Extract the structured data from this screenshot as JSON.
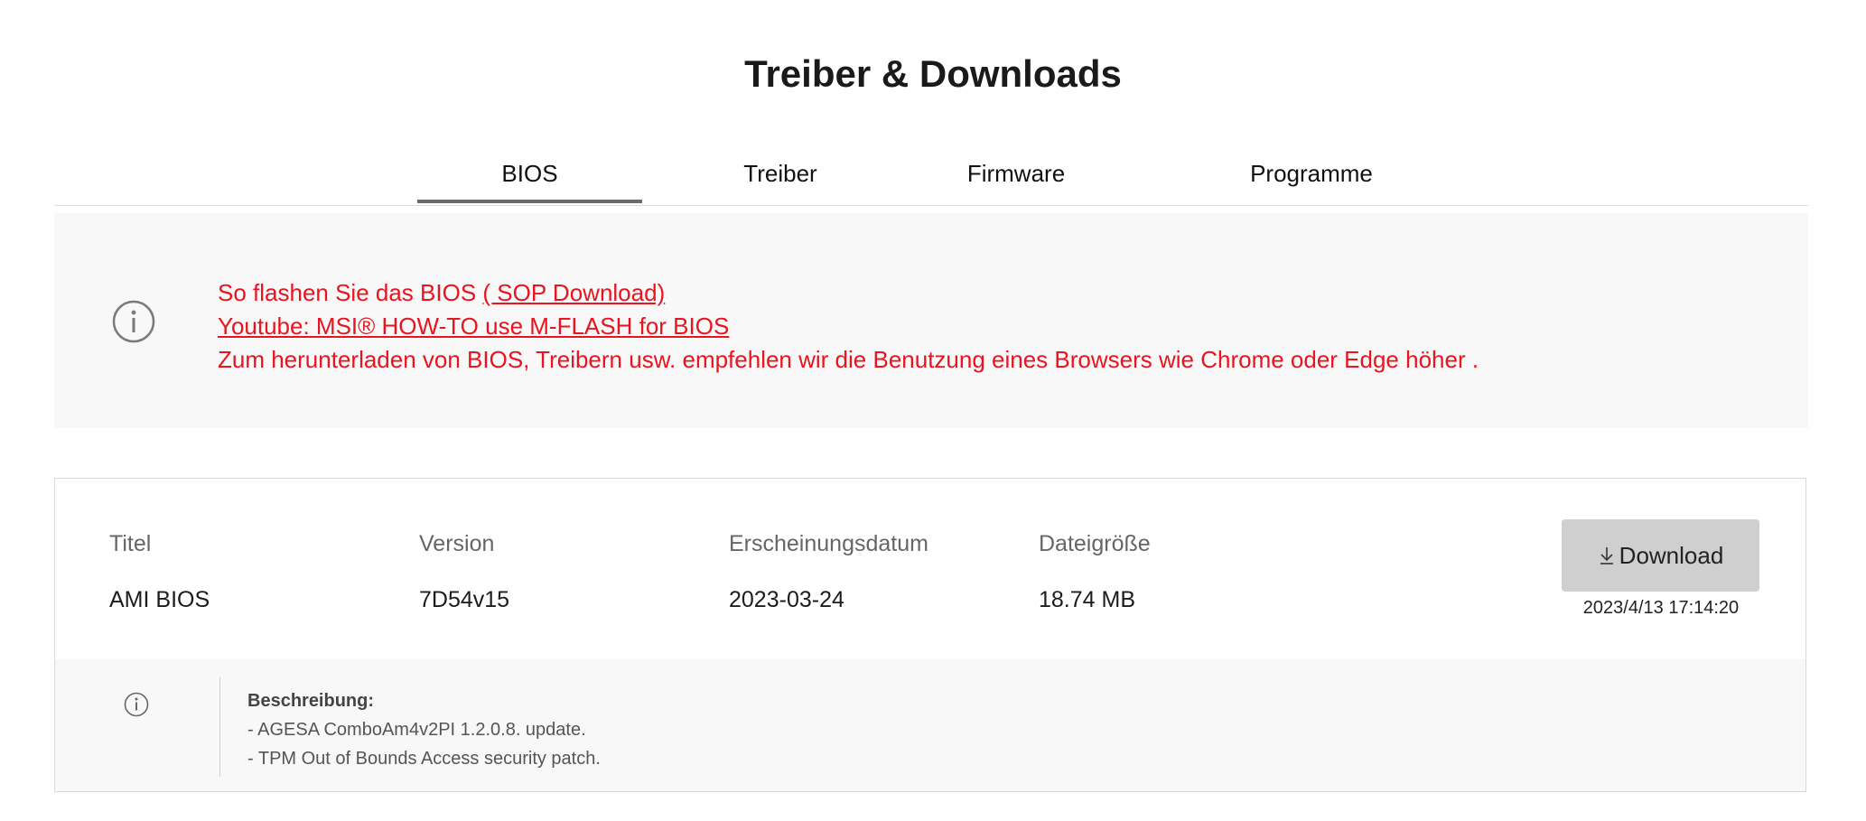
{
  "page": {
    "title": "Treiber & Downloads"
  },
  "tabs": [
    {
      "label": "BIOS",
      "active": true
    },
    {
      "label": "Treiber",
      "active": false
    },
    {
      "label": "Firmware",
      "active": false
    },
    {
      "label": "Programme",
      "active": false
    }
  ],
  "notice": {
    "icon": "info-circle-icon",
    "color": "#e8141f",
    "line1_prefix": "So flashen Sie das BIOS ",
    "line1_link": "( SOP Download)",
    "line2_link": "Youtube: MSI® HOW-TO use M-FLASH for BIOS",
    "line3": "Zum herunterladen von BIOS, Treibern usw. empfehlen wir die Benutzung eines Browsers wie Chrome oder Edge höher ."
  },
  "download": {
    "headers": {
      "title": "Titel",
      "version": "Version",
      "date": "Erscheinungsdatum",
      "size": "Dateigröße"
    },
    "row": {
      "title": "AMI BIOS",
      "version": "7D54v15",
      "date": "2023-03-24",
      "size": "18.74 MB"
    },
    "button_icon": "download-arrow-icon",
    "button_label": "Download",
    "timestamp": "2023/4/13 17:14:20",
    "description": {
      "icon": "info-circle-icon",
      "label": "Beschreibung:",
      "lines": [
        "- AGESA ComboAm4v2PI 1.2.0.8. update.",
        "- TPM Out of Bounds Access security patch."
      ]
    }
  }
}
